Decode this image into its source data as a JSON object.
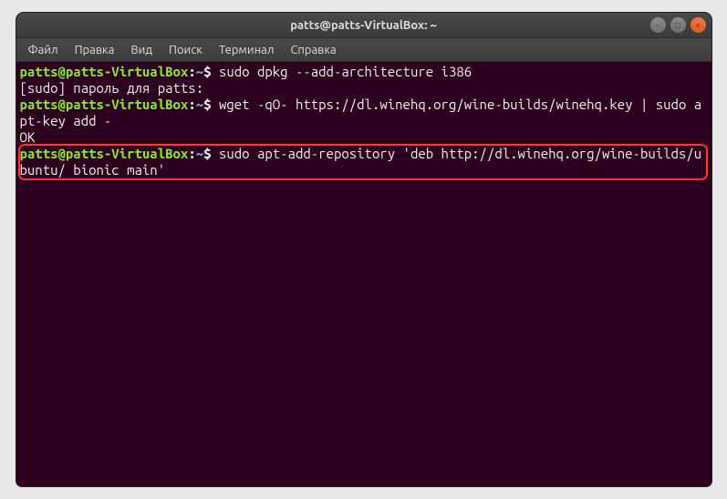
{
  "window": {
    "title": "patts@patts-VirtualBox: ~"
  },
  "menubar": {
    "items": [
      "Файл",
      "Правка",
      "Вид",
      "Поиск",
      "Терминал",
      "Справка"
    ]
  },
  "terminal": {
    "prompt_user_host": "patts@patts-VirtualBox",
    "prompt_sep": ":",
    "prompt_dir": "~",
    "prompt_end": "$ ",
    "lines": {
      "l1_cmd": "sudo dpkg --add-architecture i386",
      "l2_text": "[sudo] пароль для patts:",
      "l3_cmd": "wget -qO- https://dl.winehq.org/wine-builds/winehq.key | sudo apt-key add -",
      "l4_text": "OK",
      "l5_cmd": "sudo apt-add-repository 'deb http://dl.winehq.org/wine-builds/ubuntu/ bionic main'"
    }
  },
  "icons": {
    "minimize": "−",
    "maximize": "□",
    "close": "×"
  }
}
